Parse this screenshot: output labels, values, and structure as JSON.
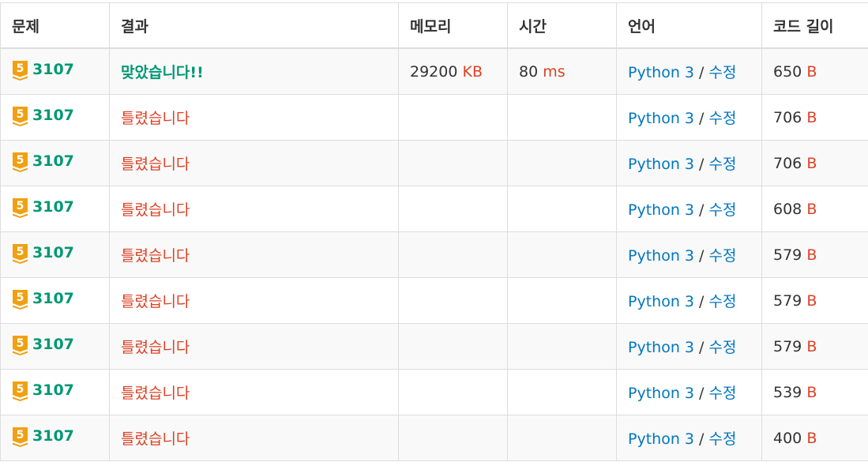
{
  "headers": {
    "problem": "문제",
    "result": "결과",
    "memory": "메모리",
    "time": "시간",
    "language": "언어",
    "code_length": "코드 길이"
  },
  "colors": {
    "accepted": "#009874",
    "wrong": "#dd4124",
    "link": "#0076c0",
    "tier_badge": "#f0a010"
  },
  "tier_icon": "gold-tier-5-badge",
  "rows": [
    {
      "tier": "5",
      "problem": "3107",
      "result": "맞았습니다!!",
      "accepted": true,
      "memory": "29200",
      "memory_unit": "KB",
      "time": "80",
      "time_unit": "ms",
      "language": "Python 3",
      "separator": "/",
      "edit": "수정",
      "code_length": "650",
      "code_unit": "B"
    },
    {
      "tier": "5",
      "problem": "3107",
      "result": "틀렸습니다",
      "accepted": false,
      "memory": "",
      "memory_unit": "",
      "time": "",
      "time_unit": "",
      "language": "Python 3",
      "separator": "/",
      "edit": "수정",
      "code_length": "706",
      "code_unit": "B"
    },
    {
      "tier": "5",
      "problem": "3107",
      "result": "틀렸습니다",
      "accepted": false,
      "memory": "",
      "memory_unit": "",
      "time": "",
      "time_unit": "",
      "language": "Python 3",
      "separator": "/",
      "edit": "수정",
      "code_length": "706",
      "code_unit": "B"
    },
    {
      "tier": "5",
      "problem": "3107",
      "result": "틀렸습니다",
      "accepted": false,
      "memory": "",
      "memory_unit": "",
      "time": "",
      "time_unit": "",
      "language": "Python 3",
      "separator": "/",
      "edit": "수정",
      "code_length": "608",
      "code_unit": "B"
    },
    {
      "tier": "5",
      "problem": "3107",
      "result": "틀렸습니다",
      "accepted": false,
      "memory": "",
      "memory_unit": "",
      "time": "",
      "time_unit": "",
      "language": "Python 3",
      "separator": "/",
      "edit": "수정",
      "code_length": "579",
      "code_unit": "B"
    },
    {
      "tier": "5",
      "problem": "3107",
      "result": "틀렸습니다",
      "accepted": false,
      "memory": "",
      "memory_unit": "",
      "time": "",
      "time_unit": "",
      "language": "Python 3",
      "separator": "/",
      "edit": "수정",
      "code_length": "579",
      "code_unit": "B"
    },
    {
      "tier": "5",
      "problem": "3107",
      "result": "틀렸습니다",
      "accepted": false,
      "memory": "",
      "memory_unit": "",
      "time": "",
      "time_unit": "",
      "language": "Python 3",
      "separator": "/",
      "edit": "수정",
      "code_length": "579",
      "code_unit": "B"
    },
    {
      "tier": "5",
      "problem": "3107",
      "result": "틀렸습니다",
      "accepted": false,
      "memory": "",
      "memory_unit": "",
      "time": "",
      "time_unit": "",
      "language": "Python 3",
      "separator": "/",
      "edit": "수정",
      "code_length": "539",
      "code_unit": "B"
    },
    {
      "tier": "5",
      "problem": "3107",
      "result": "틀렸습니다",
      "accepted": false,
      "memory": "",
      "memory_unit": "",
      "time": "",
      "time_unit": "",
      "language": "Python 3",
      "separator": "/",
      "edit": "수정",
      "code_length": "400",
      "code_unit": "B"
    }
  ]
}
